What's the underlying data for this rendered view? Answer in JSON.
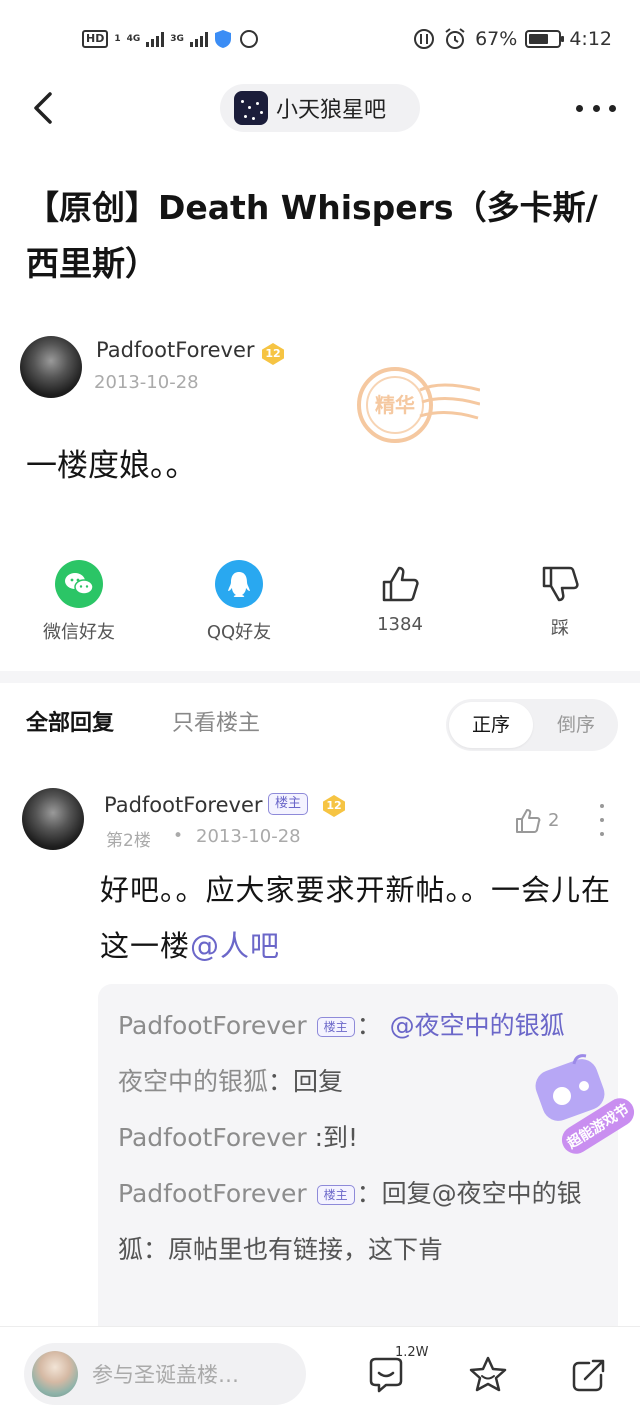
{
  "status_bar": {
    "hd": "HD",
    "sim1": "1",
    "net1": "4G",
    "net2": "3G",
    "battery_percent": "67%",
    "battery_level": 0.67,
    "time": "4:12"
  },
  "nav": {
    "forum_name": "小天狼星吧"
  },
  "post": {
    "title": "【原创】Death Whispers（多卡斯/西里斯）",
    "author": "PadfootForever",
    "author_level": "12",
    "date": "2013-10-28",
    "body": "一楼度娘。。"
  },
  "share": {
    "wechat": "微信好友",
    "qq": "QQ好友",
    "likes": "1384",
    "dislike": "踩"
  },
  "reply_tabs": {
    "all": "全部回复",
    "op_only": "只看楼主",
    "sort_asc": "正序",
    "sort_desc": "倒序"
  },
  "reply": {
    "author": "PadfootForever",
    "op_tag": "楼主",
    "level": "12",
    "floor": "第2楼",
    "dot": "•",
    "date": "2013-10-28",
    "likes": "2",
    "text_main": "好吧。。应大家要求开新帖。。一会儿在这一楼",
    "text_mention": "@人吧"
  },
  "sub_replies": [
    {
      "user": "PadfootForever",
      "op_tag": "楼主",
      "sep": "：",
      "mention": "@夜空中的银狐",
      "text": ""
    },
    {
      "user": "夜空中的银狐",
      "op_tag": "",
      "sep": "：",
      "mention": "",
      "text": "回复"
    },
    {
      "user": "PadfootForever",
      "op_tag": "",
      "sep": "",
      "mention": "",
      "text": " :到!"
    },
    {
      "user": "PadfootForever",
      "op_tag": "楼主",
      "sep": "：",
      "mention": "",
      "text": "回复@夜空中的银狐：原帖里也有链接，这下肯"
    }
  ],
  "sticker": {
    "label": "超能游戏节"
  },
  "bottom_bar": {
    "placeholder": "参与圣诞盖楼…",
    "comment_count": "1.2W"
  },
  "icons": {
    "back": "chevron-left-icon",
    "more": "more-horizontal-icon",
    "wechat": "wechat-icon",
    "qq": "qq-icon",
    "like": "thumbs-up-icon",
    "dislike": "thumbs-down-icon",
    "comment": "comment-icon",
    "favorite": "star-icon",
    "share": "share-icon"
  },
  "colors": {
    "wechat_green": "#2bc566",
    "qq_blue": "#29a8f0",
    "accent_purple": "#6b67c9",
    "badge_gold": "#f6c443",
    "stamp_orange": "#f5b98a"
  }
}
